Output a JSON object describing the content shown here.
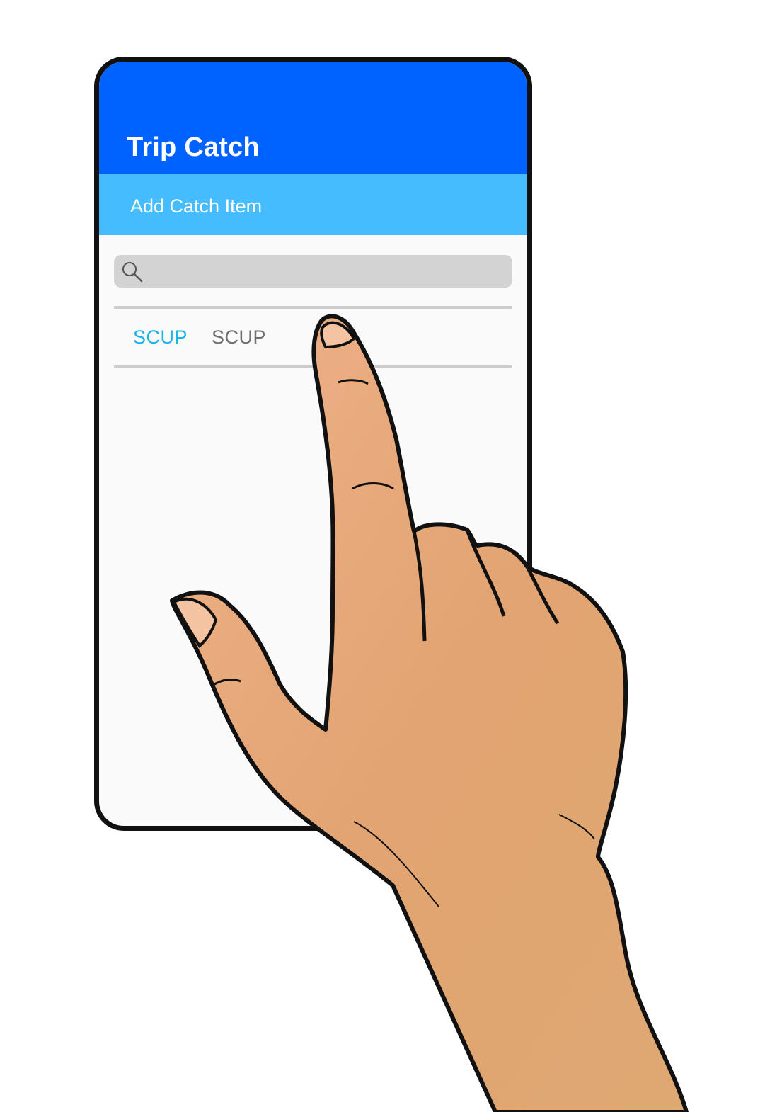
{
  "app": {
    "title": "Trip Catch",
    "subtitle": "Add Catch Item"
  },
  "search": {
    "placeholder": "",
    "value": "",
    "icon": "search-icon"
  },
  "tabs": [
    {
      "label": "SCUP",
      "active": true
    },
    {
      "label": "SCUP",
      "active": false
    }
  ],
  "colors": {
    "app_bar": "#0062ff",
    "sub_bar": "#44bcfd",
    "active_tab": "#18b4ea",
    "inactive_tab": "#6f6f6f"
  }
}
